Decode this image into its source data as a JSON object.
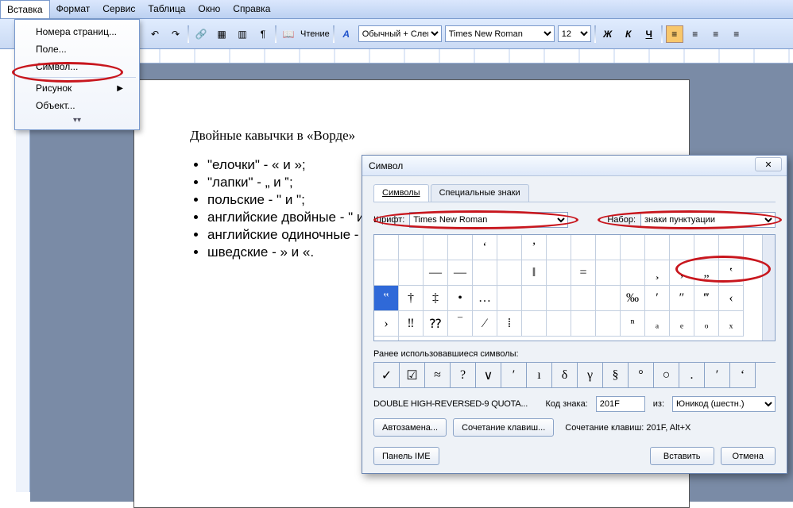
{
  "menubar": [
    "Вставка",
    "Формат",
    "Сервис",
    "Таблица",
    "Окно",
    "Справка"
  ],
  "toolbar": {
    "reading": "Чтение",
    "style": "Обычный + Слева",
    "font": "Times New Roman",
    "size": "12",
    "bold": "Ж",
    "italic": "К",
    "under": "Ч"
  },
  "dropdown": {
    "items": [
      "Номера страниц...",
      "Поле...",
      "Символ...",
      "Рисунок",
      "Объект..."
    ],
    "submenu_index": 3
  },
  "document": {
    "title": "Двойные кавычки в «Ворде»",
    "bullets": [
      "\"елочки\" - « и »;",
      "\"лапки\" - „ и ‟;",
      "польские - \" и \";",
      "английские двойные - \" и \";",
      "английские одиночные - ' и ';",
      "шведские - » и «."
    ]
  },
  "dialog": {
    "title": "Символ",
    "tabs": [
      "Символы",
      "Специальные знаки"
    ],
    "font_label": "Шрифт:",
    "font_value": "Times New Roman",
    "set_label": "Набор:",
    "set_value": "знаки пунктуации",
    "recent_label": "Ранее использовавшиеся символы:",
    "charname": "DOUBLE HIGH-REVERSED-9 QUOTA...",
    "code_label": "Код знака:",
    "code_value": "201F",
    "from_label": "из:",
    "from_value": "Юникод (шестн.)",
    "btn_auto": "Автозамена...",
    "btn_shortcut": "Сочетание клавиш...",
    "shortcut_text": "Сочетание клавиш: 201F, Alt+X",
    "btn_ime": "Панель IME",
    "btn_insert": "Вставить",
    "btn_cancel": "Отмена"
  },
  "grid_rows": [
    [
      "",
      "",
      "",
      "",
      "‘",
      "",
      "’",
      "",
      "",
      "",
      "",
      "",
      "",
      "",
      ""
    ],
    [
      "",
      "",
      "—",
      "―",
      "",
      "",
      "ǁ",
      "",
      "=",
      "",
      "",
      "¸",
      "‚",
      "„",
      "‛",
      "‟"
    ],
    [
      "†",
      "‡",
      "•",
      "…",
      "",
      "",
      "",
      "",
      "",
      "‰",
      "′",
      "″",
      "‴",
      "‹",
      "›"
    ],
    [
      "‼",
      "⁇",
      "‾",
      "⁄",
      "⁞",
      "",
      "",
      "",
      "",
      "ⁿ",
      "ₐ",
      "ₑ",
      "ₒ",
      "ₓ",
      ""
    ]
  ],
  "grid_highlight": {
    "row": 1,
    "col": 15
  },
  "recent_cells": [
    "✓",
    "☑",
    "≈",
    "?",
    "∨",
    "′",
    "ı",
    "δ",
    "γ",
    "§",
    "°",
    "○",
    ".",
    "′",
    "‘",
    "‵"
  ],
  "chart_data": null
}
